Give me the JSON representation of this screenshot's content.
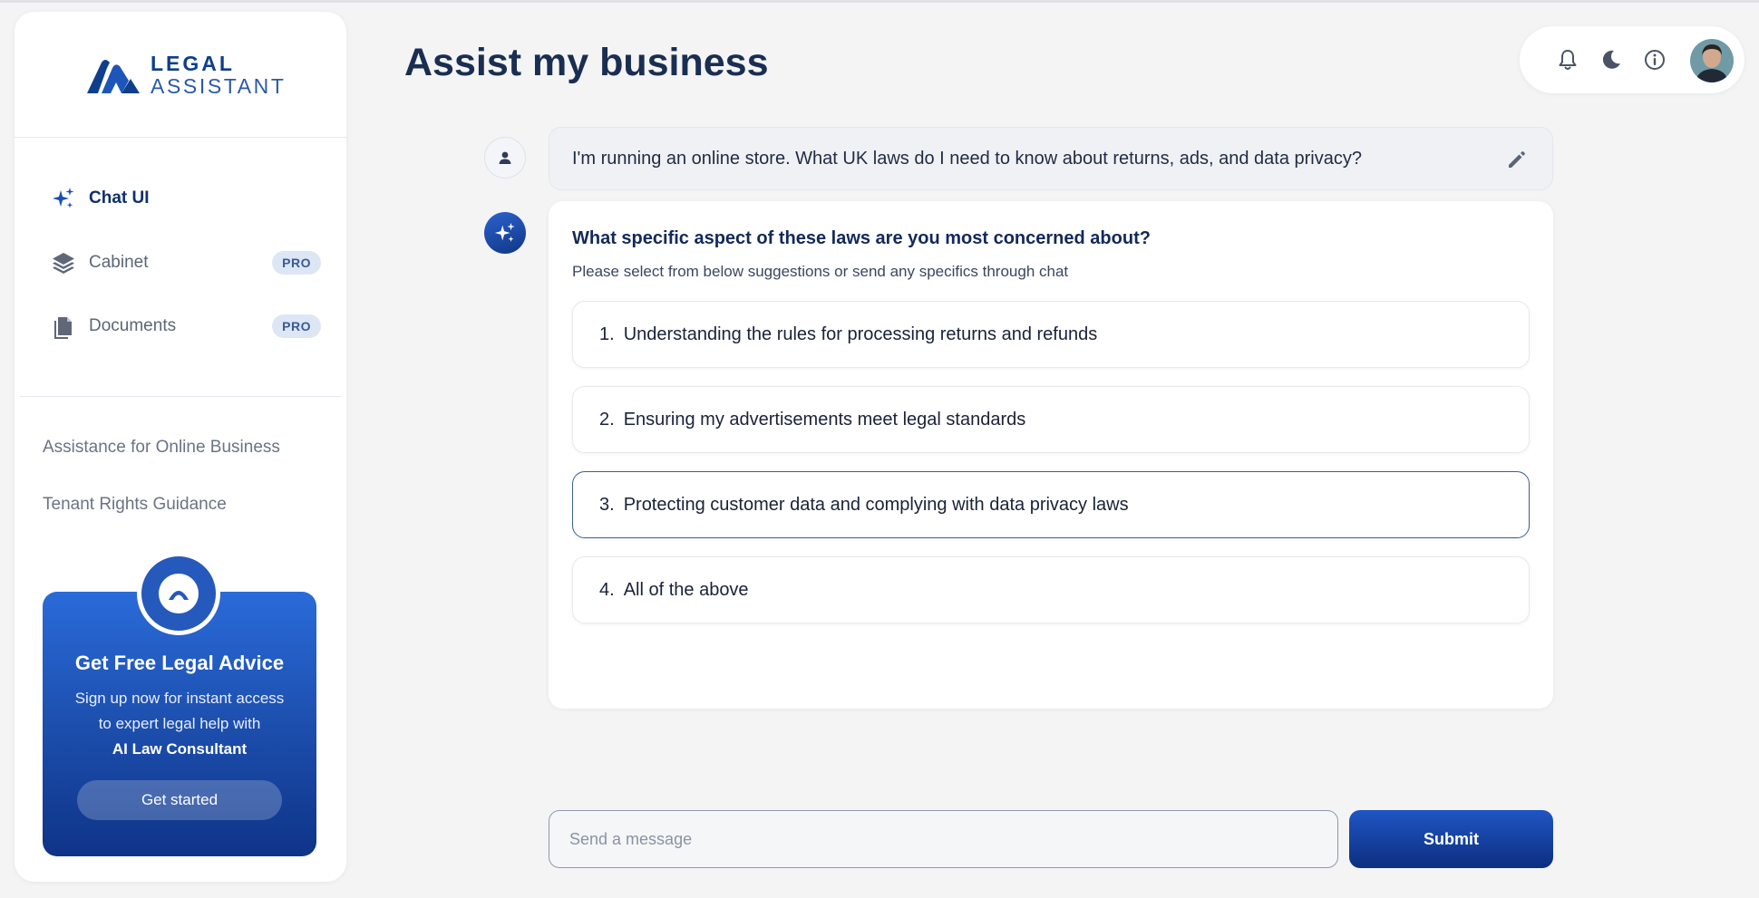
{
  "brand": {
    "line1": "LEGAL",
    "line2": "ASSISTANT"
  },
  "sidebar": {
    "nav": [
      {
        "label": "Chat UI",
        "icon": "sparkles-icon",
        "active": true
      },
      {
        "label": "Cabinet",
        "icon": "layers-icon",
        "badge": "PRO"
      },
      {
        "label": "Documents",
        "icon": "document-icon",
        "badge": "PRO"
      }
    ],
    "history": [
      {
        "label": "Assistance for Online Business"
      },
      {
        "label": "Tenant Rights Guidance"
      }
    ],
    "promo": {
      "title": "Get Free Legal Advice",
      "text_line1": "Sign up now for instant access",
      "text_line2": "to expert legal help with",
      "text_strong": "AI Law Consultant",
      "button": "Get started"
    }
  },
  "header": {
    "title": "Assist my business",
    "icons": [
      "bell-icon",
      "moon-icon",
      "info-icon"
    ]
  },
  "conversation": {
    "user_message": "I'm running an online store. What UK laws do I need to know about returns, ads, and data privacy?",
    "ai": {
      "question": "What specific aspect of these laws are you most concerned about?",
      "subtitle": "Please select from below suggestions or send any specifics through chat",
      "options": [
        {
          "num": "1.",
          "text": "Understanding the rules for processing returns and refunds"
        },
        {
          "num": "2.",
          "text": "Ensuring my advertisements meet legal standards"
        },
        {
          "num": "3.",
          "text": "Protecting customer data and complying with data privacy laws",
          "selected": true
        },
        {
          "num": "4.",
          "text": "All of the above"
        }
      ]
    }
  },
  "composer": {
    "placeholder": "Send a message",
    "submit": "Submit"
  },
  "colors": {
    "brand": "#0f3f8c",
    "accent": "#1f55c4",
    "background": "#f4f4f5"
  }
}
